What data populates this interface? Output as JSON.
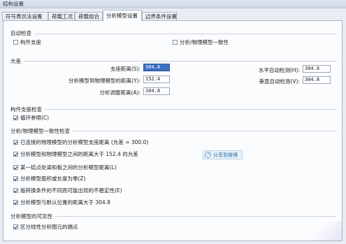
{
  "window": {
    "title": "结构设置"
  },
  "tabs": [
    {
      "label": "符号表示法设置"
    },
    {
      "label": "荷载工况"
    },
    {
      "label": "荷载组合"
    },
    {
      "label": "分析模型设置"
    },
    {
      "label": "边界条件设置"
    }
  ],
  "active_tab_index": 3,
  "auto_check": {
    "title": "自动检查",
    "member_support": {
      "label": "构件支座",
      "checked": false
    },
    "consistency": {
      "label": "分析/物理模型一致性",
      "checked": false
    }
  },
  "tolerance": {
    "title": "允差",
    "support_distance": {
      "label": "支座距离(S):",
      "value": "304.8"
    },
    "analytical_to_physical": {
      "label": "分析模型到物理模型的距离(Y):",
      "value": "152.4"
    },
    "analytical_adjust": {
      "label": "分析调整距离(A):",
      "value": "304.8"
    },
    "horizontal_auto": {
      "label": "水平自动检测(H):",
      "value": "304.8"
    },
    "vertical_auto": {
      "label": "垂直自动检测(V):",
      "value": "304.8"
    }
  },
  "member_support_check": {
    "title": "构件支座检查",
    "circular_reference": {
      "label": "循环参照(C)",
      "checked": true
    }
  },
  "consistency_check": {
    "title": "分析/物理模型一致性检查",
    "items": [
      {
        "label": "已连接的物理模型的分析模型支座距离 (允差 = 300.0)",
        "checked": true
      },
      {
        "label": "分析模型和物理模型之间的距离大于 152.4 的允差",
        "checked": true
      },
      {
        "label": "某一结点处梁和板之间的分析模型距离(L)",
        "checked": true
      },
      {
        "label": "分析模型面积或长度为零(Z)",
        "checked": true
      },
      {
        "label": "版转换条件的不同而可能出现的不稳定性(E)",
        "checked": true
      },
      {
        "label": "分析模型与默认位置的距离大于 304.8",
        "checked": true
      }
    ],
    "share_button": "分享到微博"
  },
  "visibility": {
    "title": "分析模型的可见性",
    "distinguish": {
      "label": "区分线性分析图元的端点",
      "checked": true
    }
  }
}
